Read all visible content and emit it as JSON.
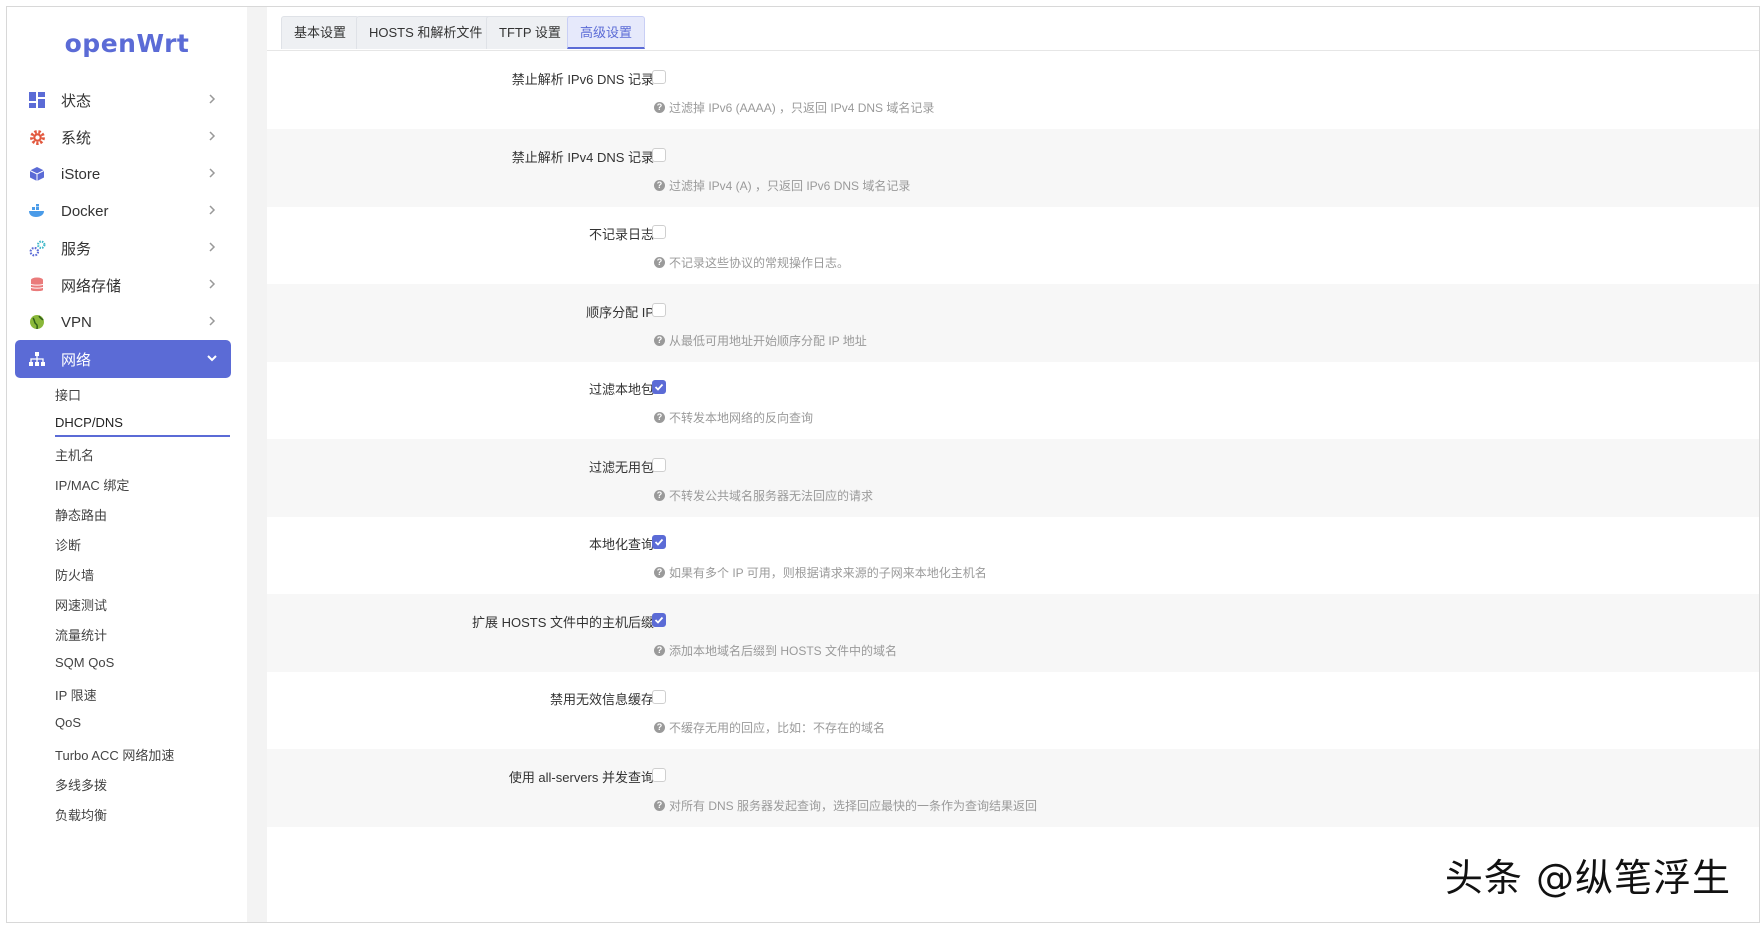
{
  "brand": {
    "logo_text": "openWrt",
    "accent": "#5b6bd6"
  },
  "sidebar": {
    "items": [
      {
        "label": "状态",
        "icon": "dashboard-icon"
      },
      {
        "label": "系统",
        "icon": "gear-icon"
      },
      {
        "label": "iStore",
        "icon": "cube-icon"
      },
      {
        "label": "Docker",
        "icon": "whale-icon"
      },
      {
        "label": "服务",
        "icon": "cogs-icon"
      },
      {
        "label": "网络存储",
        "icon": "database-icon"
      },
      {
        "label": "VPN",
        "icon": "globe-icon"
      },
      {
        "label": "网络",
        "icon": "sitemap-icon"
      }
    ],
    "active_index": 7,
    "sub_items": [
      "接口",
      "DHCP/DNS",
      "主机名",
      "IP/MAC 绑定",
      "静态路由",
      "诊断",
      "防火墙",
      "网速测试",
      "流量统计",
      "SQM QoS",
      "IP 限速",
      "QoS",
      "Turbo ACC 网络加速",
      "多线多拨",
      "负载均衡"
    ],
    "current_sub_index": 1
  },
  "tabs": [
    {
      "label": "基本设置"
    },
    {
      "label": "HOSTS 和解析文件"
    },
    {
      "label": "TFTP 设置"
    },
    {
      "label": "高级设置"
    }
  ],
  "active_tab": 3,
  "settings": [
    {
      "label": "禁止解析 IPv6 DNS 记录",
      "checked": false,
      "hint": "过滤掉 IPv6 (AAAA) ，只返回 IPv4 DNS 域名记录"
    },
    {
      "label": "禁止解析 IPv4 DNS 记录",
      "checked": false,
      "hint": "过滤掉 IPv4 (A) ，只返回 IPv6 DNS 域名记录"
    },
    {
      "label": "不记录日志",
      "checked": false,
      "hint": "不记录这些协议的常规操作日志。"
    },
    {
      "label": "顺序分配 IP",
      "checked": false,
      "hint": "从最低可用地址开始顺序分配 IP 地址"
    },
    {
      "label": "过滤本地包",
      "checked": true,
      "hint": "不转发本地网络的反向查询"
    },
    {
      "label": "过滤无用包",
      "checked": false,
      "hint": "不转发公共域名服务器无法回应的请求"
    },
    {
      "label": "本地化查询",
      "checked": true,
      "hint": "如果有多个 IP 可用，则根据请求来源的子网来本地化主机名"
    },
    {
      "label": "扩展 HOSTS 文件中的主机后缀",
      "checked": true,
      "hint": "添加本地域名后缀到 HOSTS 文件中的域名"
    },
    {
      "label": "禁用无效信息缓存",
      "checked": false,
      "hint": "不缓存无用的回应，比如：不存在的域名"
    },
    {
      "label": "使用 all-servers 并发查询",
      "checked": false,
      "hint": "对所有 DNS 服务器发起查询，选择回应最快的一条作为查询结果返回"
    }
  ],
  "watermark": "头条 @纵笔浮生"
}
